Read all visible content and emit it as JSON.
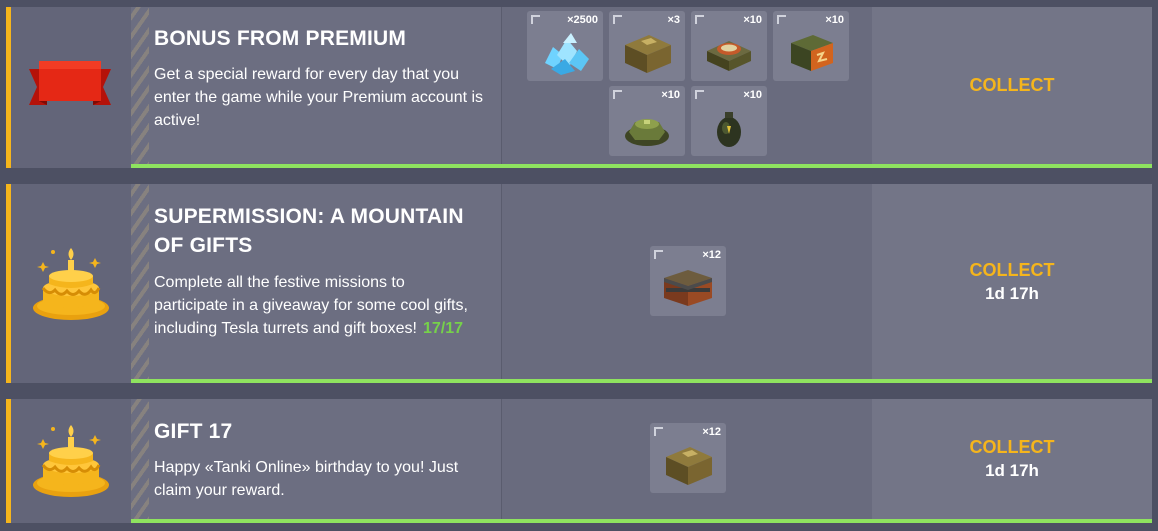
{
  "missions": [
    {
      "title": "BONUS FROM PREMIUM",
      "description": "Get a special reward for every day that you enter the game while your Premium account is active!",
      "icon": "ribbon-icon",
      "action": "COLLECT",
      "timer": "",
      "rewards": [
        {
          "name": "crystals",
          "qty": "×2500"
        },
        {
          "name": "supply-box",
          "qty": "×3"
        },
        {
          "name": "repair-kit",
          "qty": "×10"
        },
        {
          "name": "double-damage",
          "qty": "×10"
        },
        {
          "name": "mine",
          "qty": "×10"
        },
        {
          "name": "gold-grenade",
          "qty": "×10"
        }
      ]
    },
    {
      "title": "SUPERMISSION: A MOUNTAIN OF GIFTS",
      "description": "Complete all the festive missions to participate in a giveaway for some cool gifts, including Tesla turrets and gift boxes!",
      "progress": "17/17",
      "icon": "birthday-cake-icon",
      "action": "COLLECT",
      "timer": "1d 17h",
      "rewards": [
        {
          "name": "container",
          "qty": "×12"
        }
      ]
    },
    {
      "title": "GIFT 17",
      "description": "Happy «Tanki Online» birthday to you! Just claim your reward.",
      "icon": "birthday-cake-icon",
      "action": "COLLECT",
      "timer": "1d 17h",
      "rewards": [
        {
          "name": "supply-box",
          "qty": "×12"
        }
      ]
    }
  ],
  "colors": {
    "accent": "#f5b51c",
    "progress": "#8ee35f",
    "collect": "#f5b51c",
    "progress_text": "#76d14a"
  }
}
